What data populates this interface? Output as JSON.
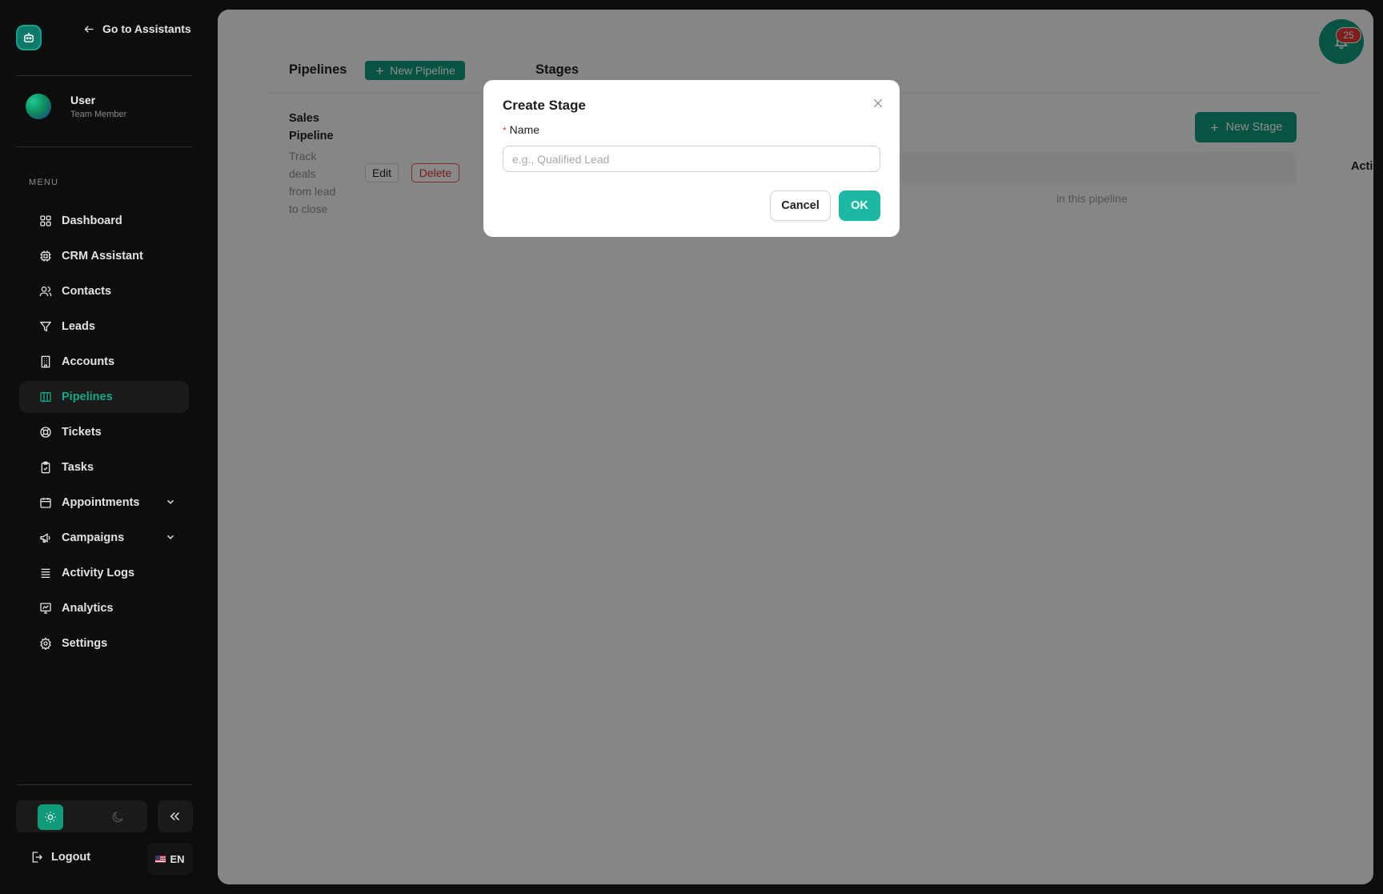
{
  "sidebar": {
    "go_back_label": "Go to Assistants",
    "user": {
      "name": "User",
      "role": "Team Member"
    },
    "menu_label": "MENU",
    "items": [
      {
        "label": "Dashboard",
        "icon": "grid-icon"
      },
      {
        "label": "CRM Assistant",
        "icon": "cpu-icon"
      },
      {
        "label": "Contacts",
        "icon": "users-icon"
      },
      {
        "label": "Leads",
        "icon": "funnel-icon"
      },
      {
        "label": "Accounts",
        "icon": "building-icon"
      },
      {
        "label": "Pipelines",
        "icon": "columns-icon",
        "active": true
      },
      {
        "label": "Tickets",
        "icon": "lifebuoy-icon"
      },
      {
        "label": "Tasks",
        "icon": "clipboard-icon"
      },
      {
        "label": "Appointments",
        "icon": "calendar-icon",
        "has_submenu": true
      },
      {
        "label": "Campaigns",
        "icon": "megaphone-icon",
        "has_submenu": true
      },
      {
        "label": "Activity Logs",
        "icon": "list-icon"
      },
      {
        "label": "Analytics",
        "icon": "chart-icon"
      },
      {
        "label": "Settings",
        "icon": "gear-icon"
      }
    ],
    "logout_label": "Logout",
    "language": "EN"
  },
  "main": {
    "pipelines_title": "Pipelines",
    "new_pipeline_label": "New Pipeline",
    "stages_title": "Stages",
    "pipeline": {
      "name": "Sales Pipeline",
      "description": "Track deals from lead to close"
    },
    "edit_label": "Edit",
    "delete_label": "Delete",
    "new_stage_label": "New Stage",
    "table": {
      "actions_header": "Actions",
      "empty_text": "in this pipeline"
    },
    "notification_count": "25"
  },
  "modal": {
    "title": "Create Stage",
    "field_label": "Name",
    "field_placeholder": "e.g., Qualified Lead",
    "cancel_label": "Cancel",
    "ok_label": "OK"
  },
  "colors": {
    "accent": "#0f9a7a",
    "ok_button": "#1cb8a4",
    "danger": "#e53935",
    "sidebar_bg": "#0d0d0d"
  }
}
